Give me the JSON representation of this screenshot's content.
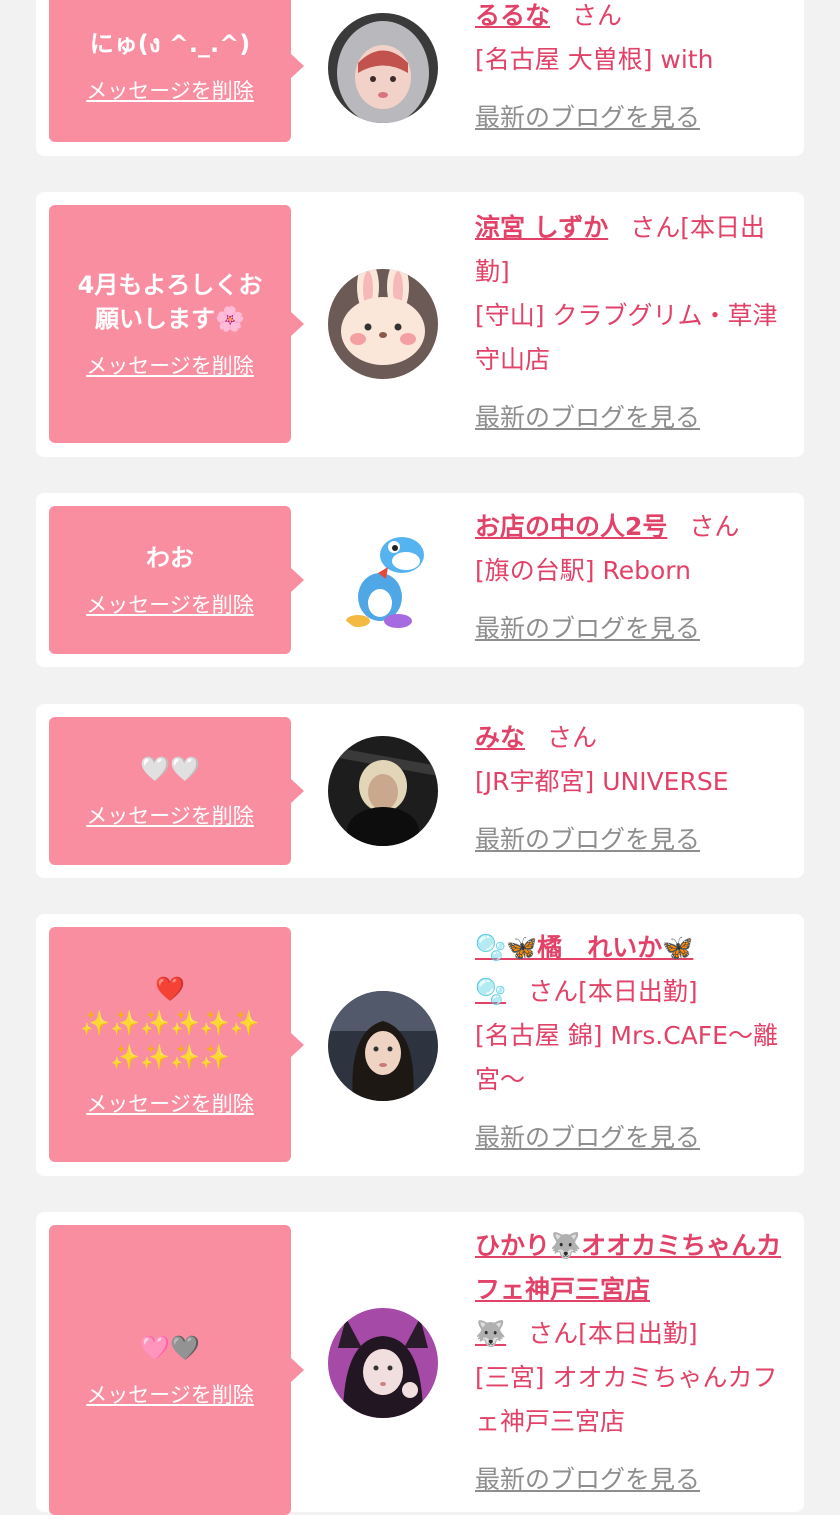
{
  "labels": {
    "delete": "メッセージを削除",
    "san": "さん",
    "blog": "最新のブログを見る"
  },
  "cards": [
    {
      "message": "にゅ(ง ^._.^)",
      "name": "るるな",
      "working_today": "",
      "shop": "[名古屋 大曽根] with",
      "avatar": "girl-in-grey-hoodie"
    },
    {
      "message": "4月もよろしくお\n願いします🌸",
      "name": "涼宮 しずか",
      "working_today": "[本日出勤]",
      "shop": "[守山] クラブグリム・草津守山店",
      "avatar": "bunny-face-filter"
    },
    {
      "message": "わお",
      "name": "お店の中の人2号",
      "working_today": "",
      "shop": "[旗の台駅] Reborn",
      "avatar": "blue-dinosaur"
    },
    {
      "message": "🤍🤍",
      "name": "みな",
      "working_today": "",
      "shop": "[JR宇都宮] UNIVERSE",
      "avatar": "blonde-woman-dark"
    },
    {
      "message": "❤️\n✨✨✨✨✨✨\n✨✨✨✨",
      "name": "🫧🦋橘　れいか🦋",
      "name_extra": "🫧",
      "working_today": "[本日出勤]",
      "shop": "[名古屋 錦] Mrs.CAFE〜離宮〜",
      "avatar": "woman-long-hair"
    },
    {
      "message": "🩷🩶",
      "name": "ひかり🐺オオカミちゃんカフェ神戸三宮店",
      "name_extra": "🐺",
      "working_today": "[本日出勤]",
      "shop": "[三宮] オオカミちゃんカフェ神戸三宮店",
      "avatar": "woman-wolf-ears"
    }
  ]
}
